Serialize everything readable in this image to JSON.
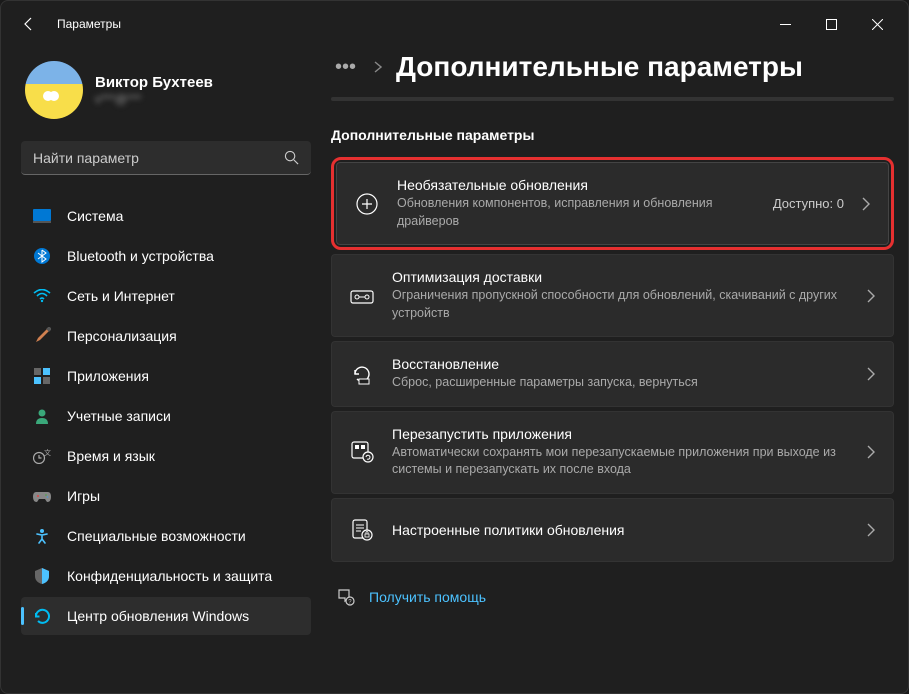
{
  "titlebar": {
    "title": "Параметры"
  },
  "user": {
    "name": "Виктор Бухтеев",
    "email": "v***@***"
  },
  "search": {
    "placeholder": "Найти параметр"
  },
  "nav": {
    "items": [
      {
        "label": "Система"
      },
      {
        "label": "Bluetooth и устройства"
      },
      {
        "label": "Сеть и Интернет"
      },
      {
        "label": "Персонализация"
      },
      {
        "label": "Приложения"
      },
      {
        "label": "Учетные записи"
      },
      {
        "label": "Время и язык"
      },
      {
        "label": "Игры"
      },
      {
        "label": "Специальные возможности"
      },
      {
        "label": "Конфиденциальность и защита"
      },
      {
        "label": "Центр обновления Windows"
      }
    ]
  },
  "breadcrumb": {
    "page_title": "Дополнительные параметры"
  },
  "section": {
    "label": "Дополнительные параметры"
  },
  "cards": [
    {
      "title": "Необязательные обновления",
      "sub": "Обновления компонентов, исправления и обновления драйверов",
      "trail": "Доступно: 0"
    },
    {
      "title": "Оптимизация доставки",
      "sub": "Ограничения пропускной способности для обновлений, скачиваний с других устройств"
    },
    {
      "title": "Восстановление",
      "sub": "Сброс, расширенные параметры запуска, вернуться"
    },
    {
      "title": "Перезапустить приложения",
      "sub": "Автоматически сохранять мои перезапускаемые приложения при выходе из системы и перезапускать их после входа"
    },
    {
      "title": "Настроенные политики обновления"
    }
  ],
  "help": {
    "label": "Получить помощь"
  }
}
